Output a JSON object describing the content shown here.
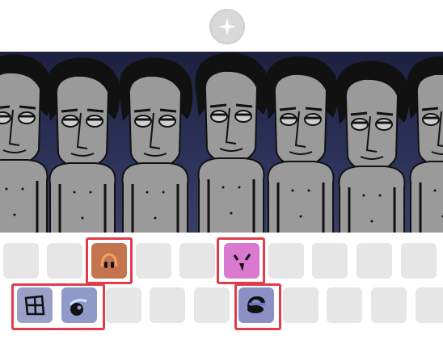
{
  "app": {
    "accent": "#e23b4a",
    "stage_color": "#2c3158"
  },
  "top": {
    "button_icon": "sparkle-icon"
  },
  "stage": {
    "character_count": 7
  },
  "tray": {
    "row1": [
      {
        "filled": false
      },
      {
        "filled": false
      },
      {
        "filled": true,
        "icon": "orange-face-sound-icon",
        "color": "#c4744e",
        "highlighted": true
      },
      {
        "filled": false
      },
      {
        "filled": false
      },
      {
        "filled": true,
        "icon": "pink-face-sound-icon",
        "color": "#d97ad0",
        "highlighted": true
      },
      {
        "filled": false
      },
      {
        "filled": false
      },
      {
        "filled": false
      },
      {
        "filled": false
      }
    ],
    "row2": [
      {
        "filled": true,
        "icon": "grid-sound-icon",
        "color": "#9aa0c8",
        "highlighted": true
      },
      {
        "filled": true,
        "icon": "eye-sound-icon",
        "color": "#8e9bc9",
        "highlighted": true
      },
      {
        "filled": false
      },
      {
        "filled": false
      },
      {
        "filled": false
      },
      {
        "filled": true,
        "icon": "headphones-sound-icon",
        "color": "#8c8fc4",
        "highlighted": true
      },
      {
        "filled": false
      },
      {
        "filled": false
      },
      {
        "filled": false
      },
      {
        "filled": false
      }
    ]
  }
}
